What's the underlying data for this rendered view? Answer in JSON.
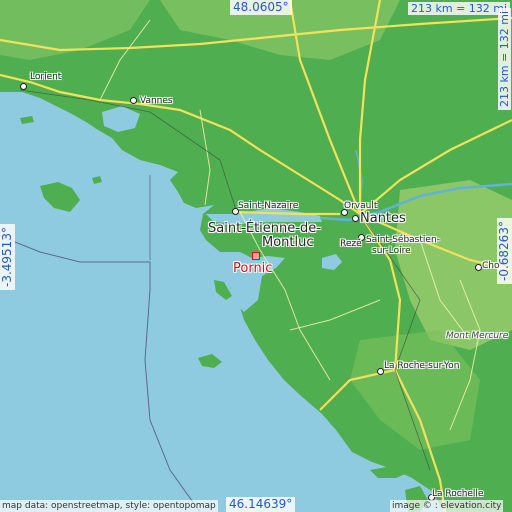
{
  "map": {
    "selected_place": "Pornic",
    "colors": {
      "sea": "#8fcbe0",
      "land": "#4fae50",
      "highland": "#9fcf6f",
      "roads": "#f2e25a",
      "marker": "#d01018"
    }
  },
  "coords": {
    "top": "48.0605°",
    "bottom": "46.14639°",
    "left": "-3.49513°",
    "right": "-0.68263°"
  },
  "scale": {
    "horizontal": "213 km = 132 mi",
    "vertical": "213 km = 132 mi"
  },
  "places": {
    "lorient": "Lorient",
    "vannes": "Vannes",
    "saint_nazaire": "Saint-Nazaire",
    "orvault": "Orvault",
    "nantes": "Nantes",
    "saint_etienne_line1": "Saint-Étienne-de-",
    "saint_etienne_line2": "Montluc",
    "reze": "Rezé",
    "saint_sebastien_line1": "Saint-Sébastien-",
    "saint_sebastien_line2": "sur-Loire",
    "cholet": "Cho",
    "mont_mercure": "Mont Mercure",
    "la_roche": "La Roche-sur-Yon",
    "la_rochelle": "La Rochelle",
    "pornic": "Pornic"
  },
  "attribution": {
    "left": "map data: openstreetmap, style: opentopomap",
    "right": "image ©   : elevation.city"
  }
}
